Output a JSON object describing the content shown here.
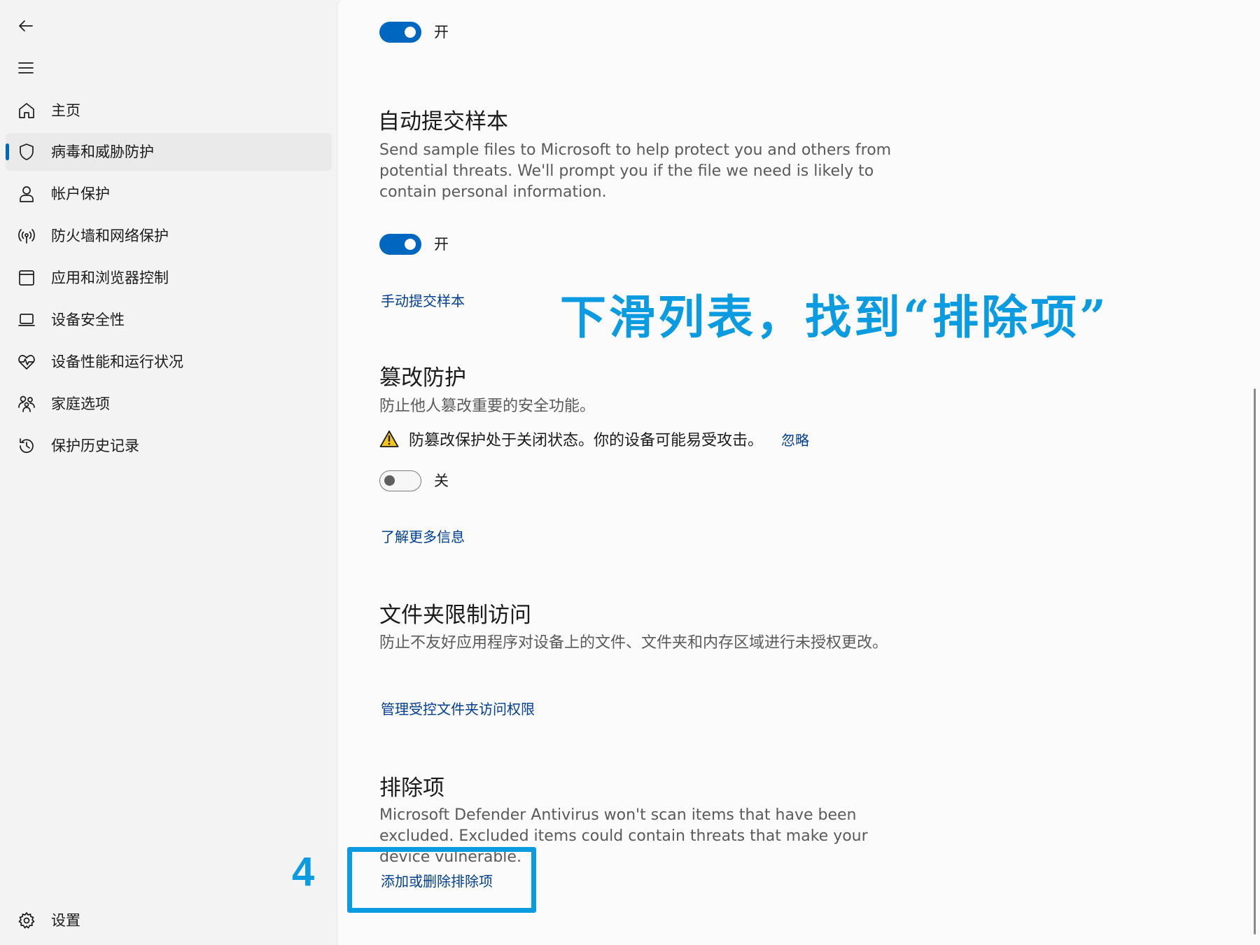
{
  "sidebar": {
    "items": [
      {
        "label": "主页",
        "icon": "home-icon"
      },
      {
        "label": "病毒和威胁防护",
        "icon": "shield-icon",
        "selected": true
      },
      {
        "label": "帐户保护",
        "icon": "person-icon"
      },
      {
        "label": "防火墙和网络保护",
        "icon": "wifi-antenna-icon"
      },
      {
        "label": "应用和浏览器控制",
        "icon": "browser-window-icon"
      },
      {
        "label": "设备安全性",
        "icon": "laptop-icon"
      },
      {
        "label": "设备性能和运行状况",
        "icon": "heart-pulse-icon"
      },
      {
        "label": "家庭选项",
        "icon": "family-icon"
      },
      {
        "label": "保护历史记录",
        "icon": "history-icon"
      }
    ],
    "settings_label": "设置"
  },
  "content": {
    "top_toggle_label": "开",
    "auto_sample": {
      "title": "自动提交样本",
      "description": "Send sample files to Microsoft to help protect you and others from potential threats. We'll prompt you if the file we need is likely to contain personal information.",
      "toggle_label": "开",
      "link": "手动提交样本"
    },
    "tamper": {
      "title": "篡改防护",
      "description": "防止他人篡改重要的安全功能。",
      "warning": "防篡改保护处于关闭状态。你的设备可能易受攻击。",
      "dismiss_link": "忽略",
      "toggle_label": "关",
      "link": "了解更多信息"
    },
    "folder_access": {
      "title": "文件夹限制访问",
      "description": "防止不友好应用程序对设备上的文件、文件夹和内存区域进行未授权更改。",
      "link": "管理受控文件夹访问权限"
    },
    "exclusions": {
      "title": "排除项",
      "description": "Microsoft Defender Antivirus won't scan items that have been excluded. Excluded items could contain threats that make your device vulnerable.",
      "link": "添加或删除排除项"
    }
  },
  "annotation": {
    "instruction": "下滑列表，找到“排除项”",
    "step_number": "4"
  },
  "colors": {
    "accent": "#0067c0",
    "link": "#003e92",
    "annotation": "#0b9be0",
    "warning": "#f5c518"
  }
}
